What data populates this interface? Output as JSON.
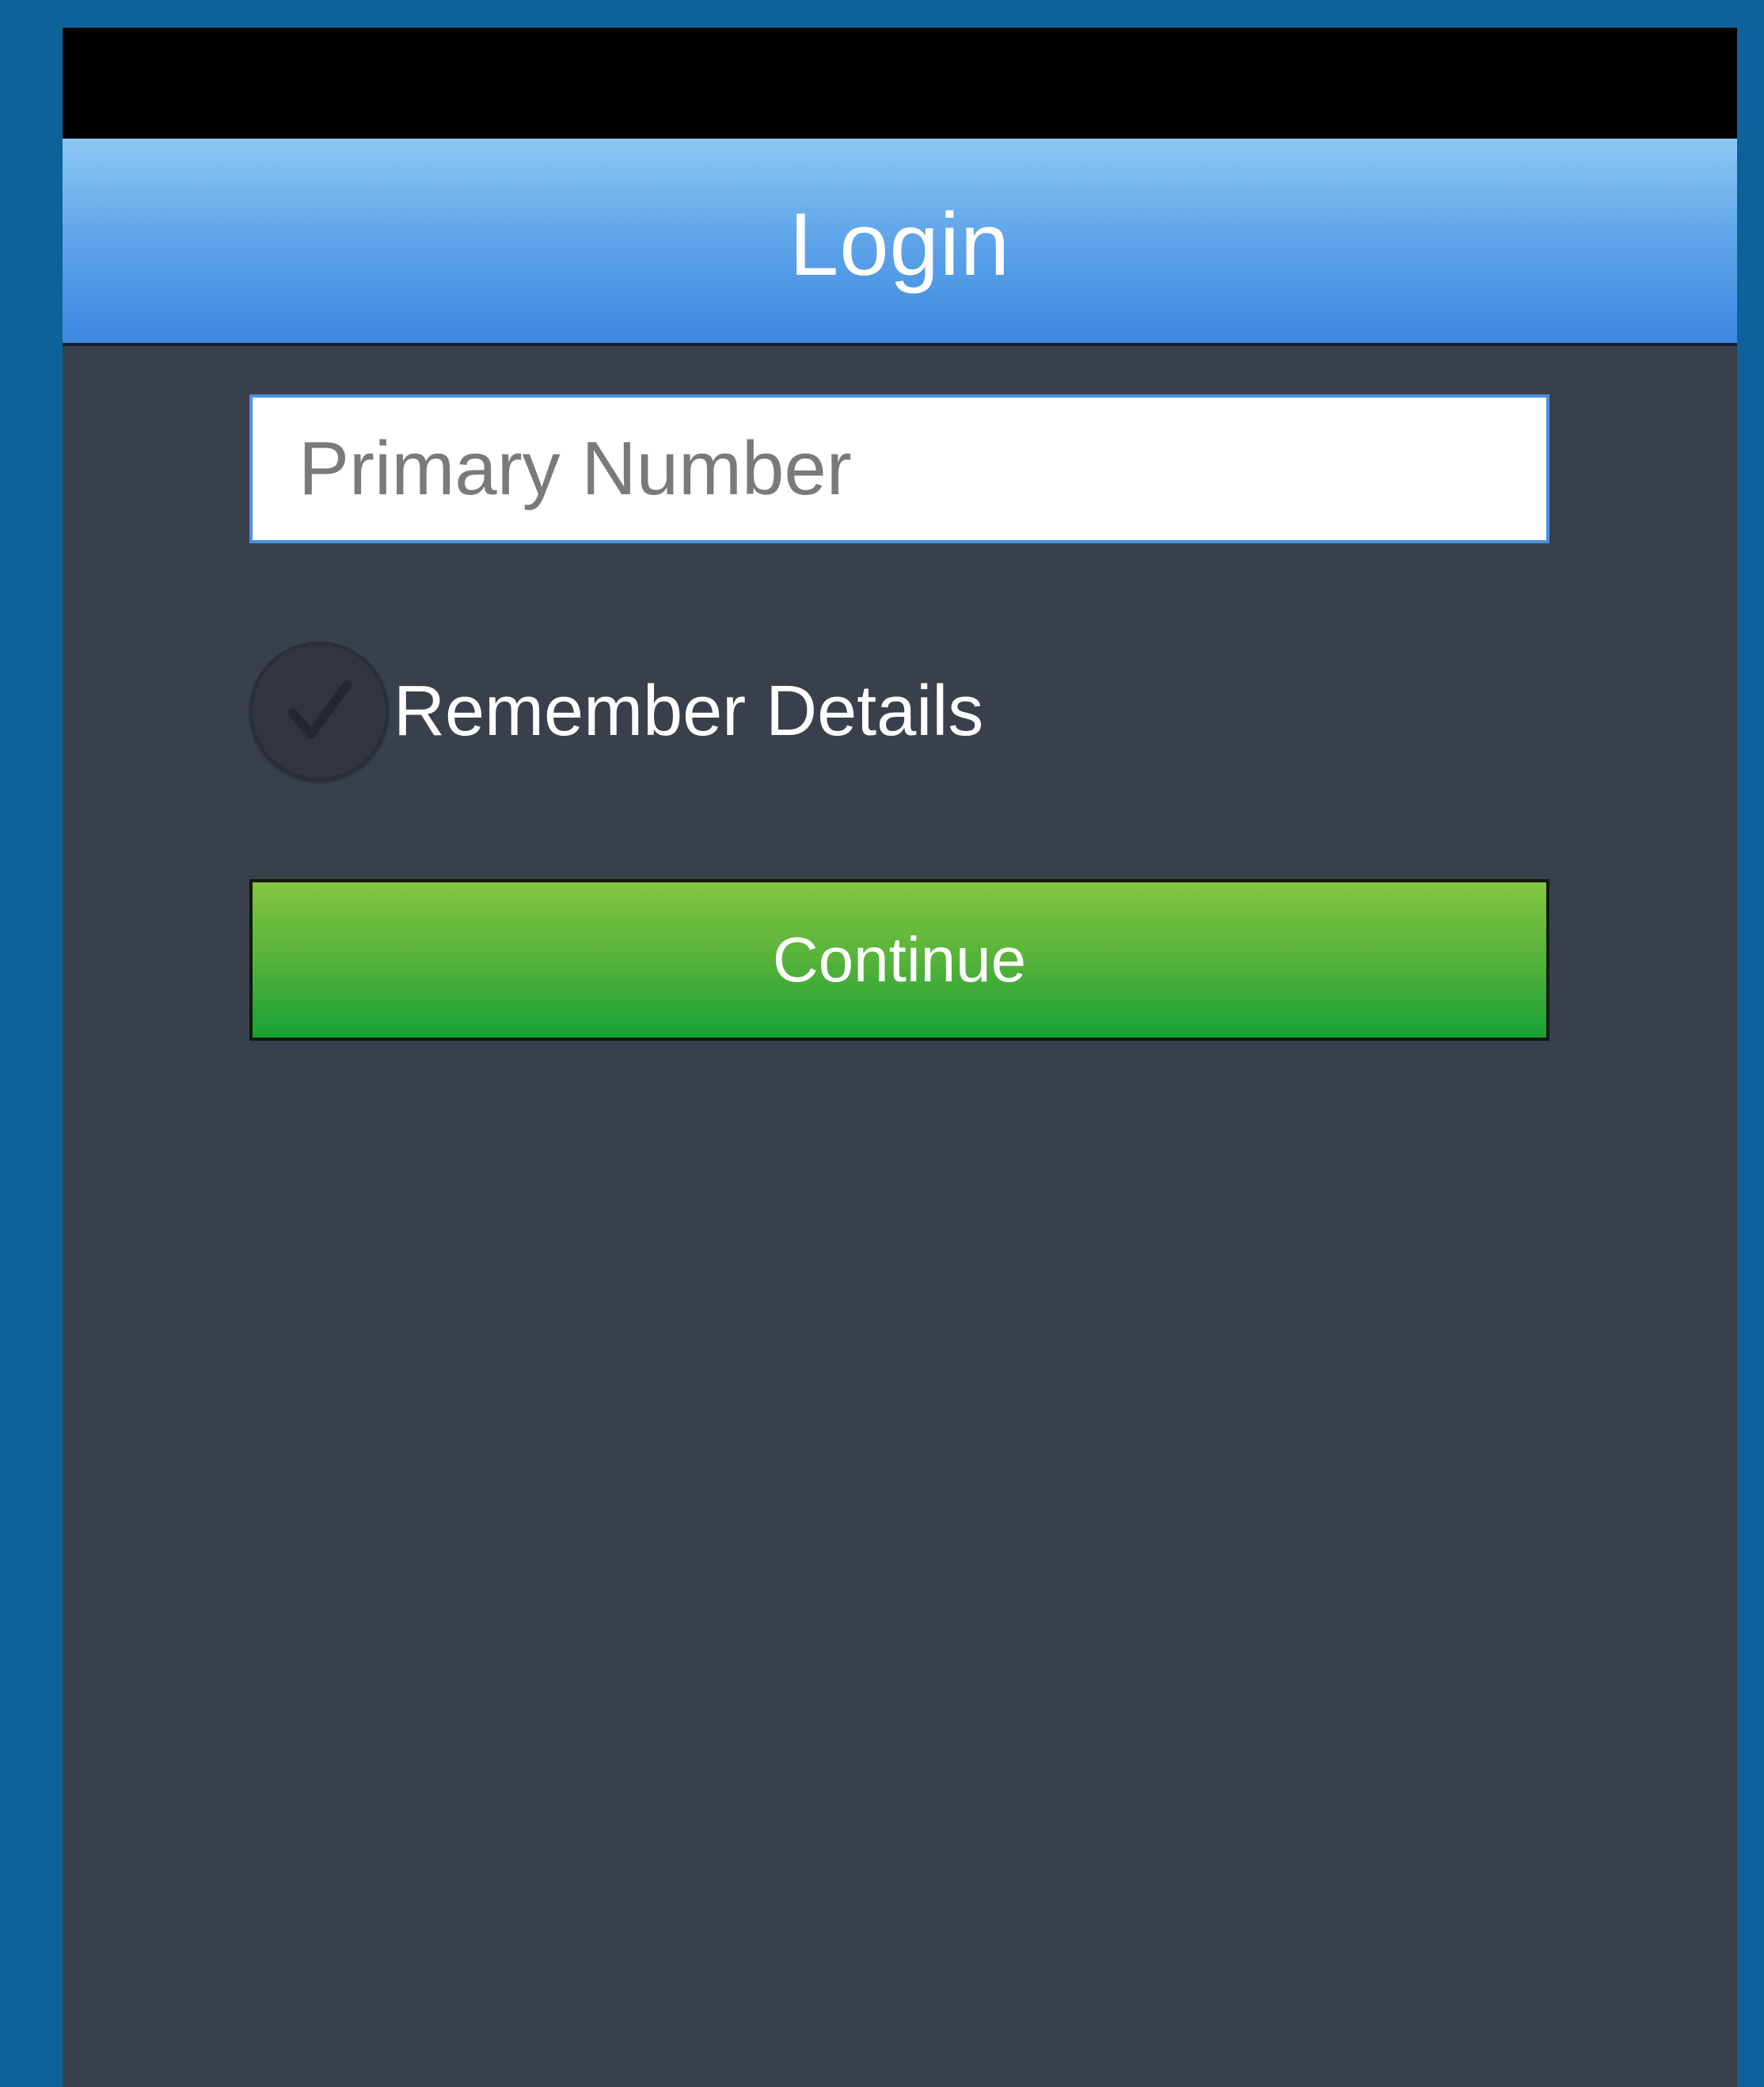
{
  "header": {
    "title": "Login"
  },
  "form": {
    "number_placeholder": "Primary Number",
    "number_value": "",
    "remember_label": "Remember Details",
    "remember_checked": true,
    "continue_label": "Continue"
  },
  "colors": {
    "background": "#0d6399",
    "panel": "#3a404b",
    "header_top": "#8ec8f4",
    "header_bottom": "#3d87e0",
    "button_top": "#84c641",
    "button_bottom": "#17a034"
  },
  "icons": {
    "checkbox": "check-icon"
  }
}
